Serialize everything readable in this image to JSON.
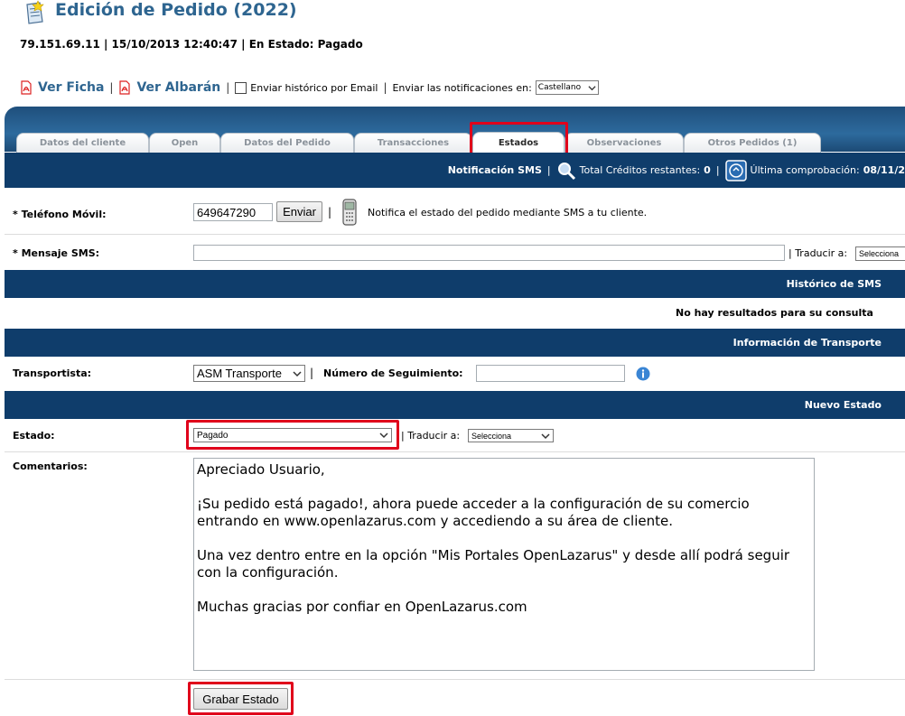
{
  "header": {
    "title": "Edición de Pedido (2022)",
    "subtitle": "79.151.69.11 | 15/10/2013 12:40:47 | En Estado: Pagado"
  },
  "links": {
    "ver_ficha": "Ver Ficha",
    "ver_albaran": "Ver Albarán",
    "separator": "|",
    "email_history_label": "Enviar histórico por Email",
    "notifications_label": "Enviar las notificaciones en:",
    "language_value": "Castellano"
  },
  "tabs": [
    {
      "label": "Datos del cliente"
    },
    {
      "label": "Open"
    },
    {
      "label": "Datos del Pedido"
    },
    {
      "label": "Transacciones"
    },
    {
      "label": "Estados"
    },
    {
      "label": "Observaciones"
    },
    {
      "label": "Otros Pedidos (1)"
    }
  ],
  "sms_bar": {
    "title": "Notificación SMS",
    "credits_label": "Total Créditos restantes:",
    "credits_value": "0",
    "last_check_label": "Última comprobación:",
    "last_check_value": "08/11/2"
  },
  "sms_form": {
    "phone_label": "* Teléfono Móvil:",
    "phone_value": "649647290",
    "send_button": "Enviar",
    "notify_text": "Notifica el estado del pedido mediante SMS a tu cliente.",
    "message_label": "* Mensaje SMS:",
    "message_value": "",
    "translate_label": "| Traducir a:",
    "translate_value": "Selecciona"
  },
  "sms_history": {
    "title": "Histórico de SMS",
    "empty_text": "No hay resultados para su consulta"
  },
  "transport": {
    "title": "Información de Transporte",
    "carrier_label": "Transportista:",
    "carrier_value": "ASM Transporte",
    "tracking_label": "Número de Seguimiento:",
    "tracking_value": ""
  },
  "new_state": {
    "title": "Nuevo Estado",
    "state_label": "Estado:",
    "state_value": "Pagado",
    "translate_label": "| Traducir a:",
    "translate_value": "Selecciona",
    "comments_label": "Comentarios:",
    "comments_value": "Apreciado Usuario,\n\n¡Su pedido está pagado!, ahora puede acceder a la configuración de su comercio entrando en www.openlazarus.com y accediendo a su área de cliente.\n\nUna vez dentro entre en la opción \"Mis Portales OpenLazarus\" y desde allí podrá seguir con la configuración.\n\nMuchas gracias por confiar en OpenLazarus.com",
    "save_button": "Grabar Estado"
  },
  "colors": {
    "navy": "#0f3d6b",
    "title_blue": "#2e6590",
    "highlight_red": "#e0001b"
  }
}
